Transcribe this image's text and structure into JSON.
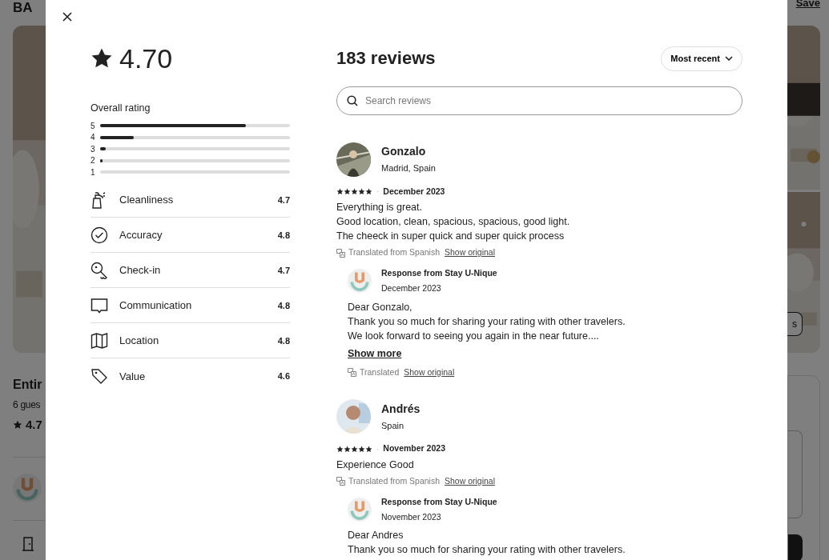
{
  "background_page": {
    "title": "BA",
    "save_link": "Save",
    "photo_button": "s",
    "listing_title": "Entir",
    "guests": "6 gues",
    "rating": "4.7"
  },
  "modal": {
    "overall": {
      "score": "4.70",
      "label": "Overall rating",
      "distribution": [
        {
          "star": "5",
          "level": 0.77
        },
        {
          "star": "4",
          "level": 0.18
        },
        {
          "star": "3",
          "level": 0.03
        },
        {
          "star": "2",
          "level": 0.015
        },
        {
          "star": "1",
          "level": 0
        }
      ]
    },
    "categories": [
      {
        "label": "Cleanliness",
        "value": "4.7"
      },
      {
        "label": "Accuracy",
        "value": "4.8"
      },
      {
        "label": "Check-in",
        "value": "4.7"
      },
      {
        "label": "Communication",
        "value": "4.8"
      },
      {
        "label": "Location",
        "value": "4.8"
      },
      {
        "label": "Value",
        "value": "4.6"
      }
    ],
    "reviews_title": "183 reviews",
    "sort": "Most recent",
    "search": {
      "placeholder": "Search reviews"
    },
    "reviews": [
      {
        "name": "Gonzalo",
        "location": "Madrid, Spain",
        "stars": 5,
        "dot": "·",
        "date": "December 2023",
        "text": "Everything is great.\nGood location, clean, spacious, spacious, good light.\nThe cheeck in super quick and super quick process",
        "translation": "Translated from Spanish",
        "show_original": "Show original",
        "response": {
          "title": "Response from Stay U-Nique",
          "date": "December 2023",
          "text": "Dear Gonzalo,\nThank you so much for sharing your rating with other travelers.\nWe look forward to seeing you again in the near future....",
          "show_more": "Show more",
          "translation": "Translated",
          "show_original": "Show original"
        }
      },
      {
        "name": "Andrés",
        "location": "Spain",
        "stars": 5,
        "dot": "·",
        "date": "November 2023",
        "text": "Experience Good",
        "translation": "Translated from Spanish",
        "show_original": "Show original",
        "response": {
          "title": "Response from Stay U-Nique",
          "date": "November 2023",
          "text": "Dear Andres\nThank you so much for sharing your rating with other travelers."
        }
      }
    ]
  }
}
